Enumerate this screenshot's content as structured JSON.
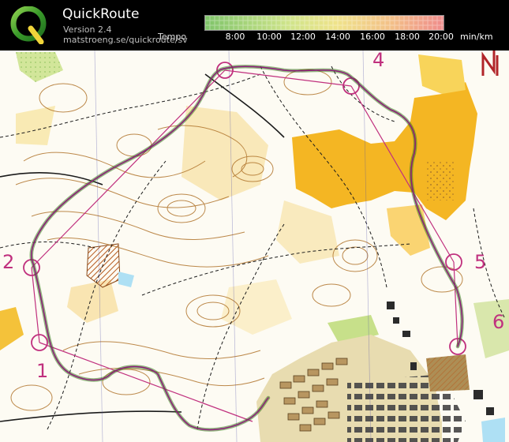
{
  "app": {
    "name": "QuickRoute",
    "version": "Version 2.4",
    "url": "matstroeng.se/quickroute/sv"
  },
  "legend": {
    "label": "Tempo",
    "ticks": [
      "8:00",
      "10:00",
      "12:00",
      "14:00",
      "16:00",
      "18:00",
      "20:00"
    ],
    "unit": "min/km",
    "colors": {
      "fast": "#3a9a2a",
      "mid": "#f0e050",
      "slow": "#e03b3b"
    }
  },
  "map": {
    "controls": [
      {
        "label": "1"
      },
      {
        "label": "2"
      },
      {
        "label": "4"
      },
      {
        "label": "5"
      },
      {
        "label": "6"
      }
    ],
    "north_marker": "N",
    "colors": {
      "route": "#8d1a7a",
      "course": "#c0307e",
      "open_land": "#f4b623",
      "rough_open": "#f7d783",
      "green_veg": "#c7e08a",
      "built_area": "#ad8e55",
      "buildings": "#4b4b4b",
      "contours": "#b1752d",
      "paths": "#1b1b1b"
    },
    "icons": [
      "quickroute-logo-icon",
      "north-arrow-icon"
    ]
  }
}
